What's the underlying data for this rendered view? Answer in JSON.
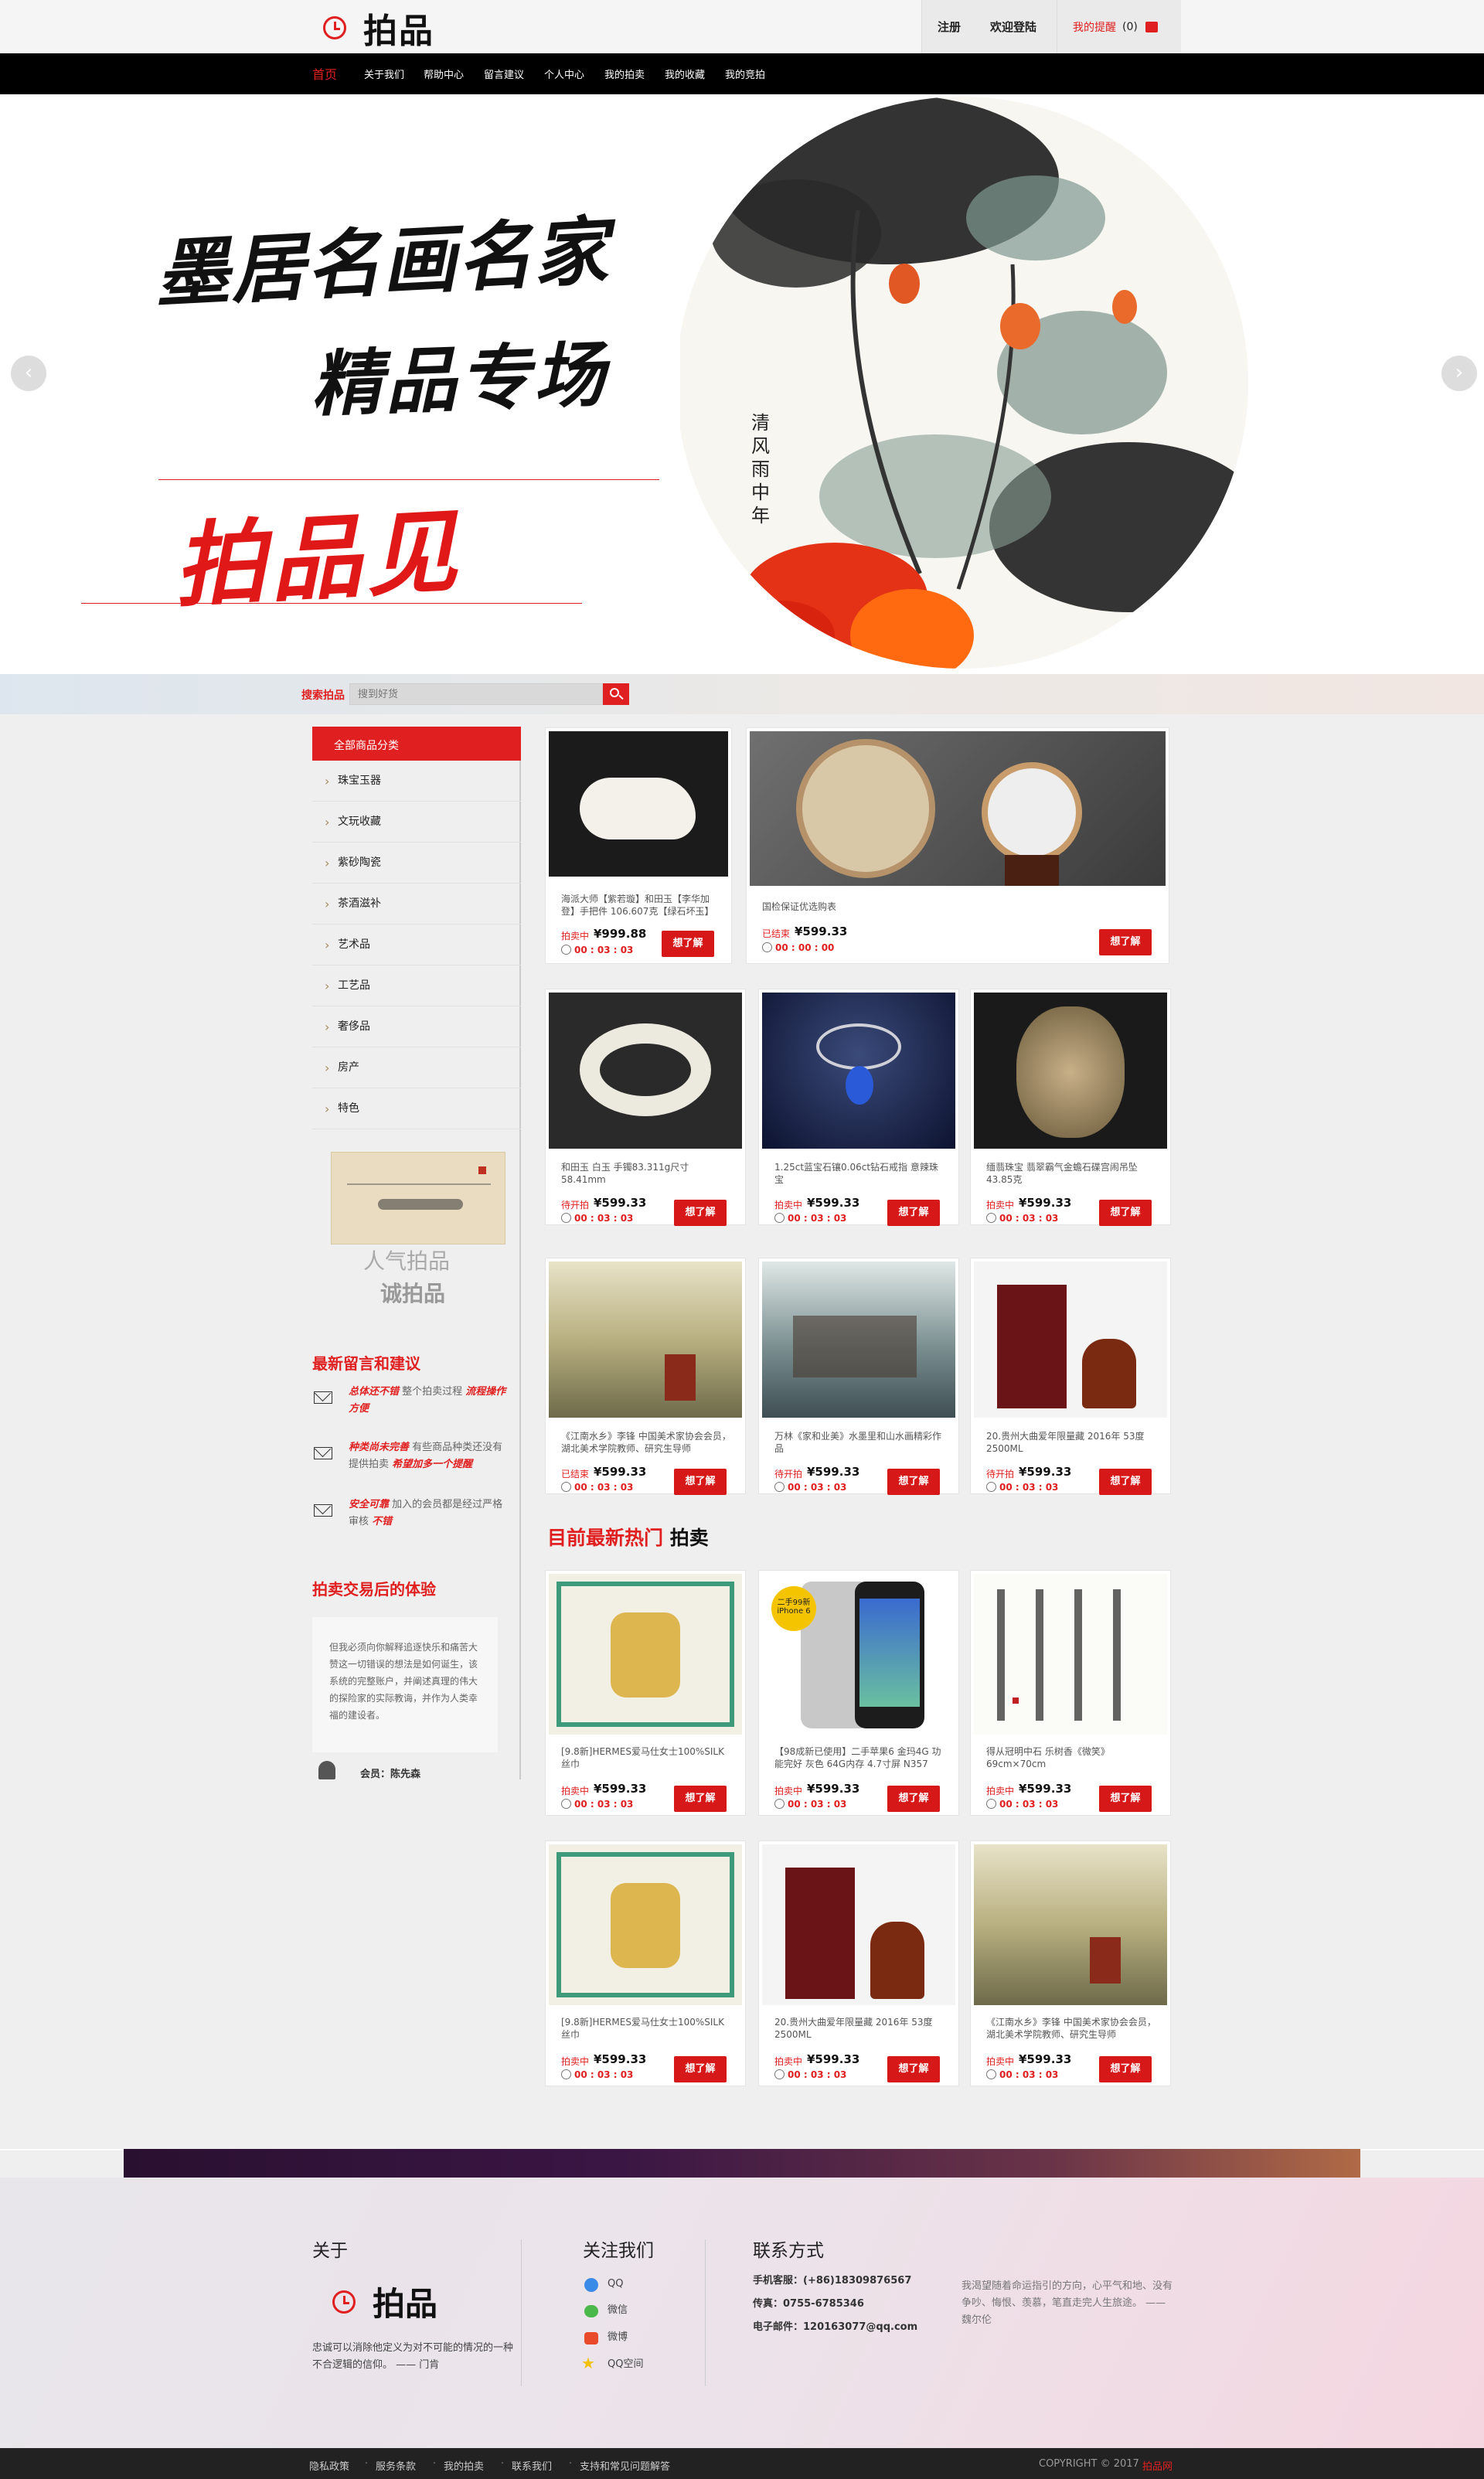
{
  "header": {
    "logo_text": "拍品",
    "register": "注册",
    "login": "欢迎登陆",
    "my_reminder": "我的提醒",
    "reminder_count": "(0)"
  },
  "nav": {
    "items": [
      "首页",
      "关于我们",
      "帮助中心",
      "留言建议",
      "个人中心",
      "我的拍卖",
      "我的收藏",
      "我的竞拍"
    ]
  },
  "banner": {
    "line1": "墨居名画名家",
    "line2": "精品专场",
    "line3": "拍品见",
    "seal_text": "清风雨中年",
    "prev": "‹",
    "next": "›"
  },
  "search": {
    "label": "搜索拍品",
    "placeholder": "搜到好货"
  },
  "sidebar": {
    "category_head": "全部商品分类",
    "categories": [
      "珠宝玉器",
      "文玩收藏",
      "紫砂陶瓷",
      "茶酒滋补",
      "艺术品",
      "工艺品",
      "奢侈品",
      "房产",
      "特色"
    ],
    "promo_line1": "人气拍品",
    "promo_line2": "诚拍品",
    "messages_title": "最新留言和建议",
    "messages": [
      {
        "highlight": "总体还不错",
        "text": " 整个拍卖过程 ",
        "highlight2": "流程操作方便"
      },
      {
        "highlight": "种类尚未完善",
        "text": " 有些商品种类还没有提供拍卖 ",
        "highlight2": "希望加多一个提醒"
      },
      {
        "highlight": "安全可靠",
        "text": " 加入的会员都是经过严格审核 ",
        "highlight2": "不错"
      }
    ],
    "experience_title": "拍卖交易后的体验",
    "experience_quote": "但我必须向你解释追逐快乐和痛苦大赞这一切错误的想法是如何诞生，该系统的完整账户，并阐述真理的伟大的探险家的实际教诲，并作为人类幸福的建设者。",
    "member_label": "会员：陈先森"
  },
  "products": [
    {
      "name": "海派大师【紫若璇】和田玉【李华加登】手把件 106.607克【绿石坏玉】",
      "status": "拍卖中",
      "price": "¥999.88",
      "time": "00 : 03 : 03",
      "btn": "想了解"
    },
    {
      "name": "国检保证优选购表",
      "status": "已结束",
      "price": "¥599.33",
      "time": "00 : 00 : 00",
      "btn": "想了解"
    },
    {
      "name": "和田玉 白玉 手镯83.311g尺寸58.41mm",
      "status": "待开拍",
      "price": "¥599.33",
      "time": "00 : 03 : 03",
      "btn": "想了解"
    },
    {
      "name": "1.25ct蓝宝石镶0.06ct钻石戒指 意辣珠宝",
      "status": "拍卖中",
      "price": "¥599.33",
      "time": "00 : 03 : 03",
      "btn": "想了解"
    },
    {
      "name": "缅翡珠宝 翡翠霸气金蟾石碟宫闹吊坠43.85克",
      "status": "拍卖中",
      "price": "¥599.33",
      "time": "00 : 03 : 03",
      "btn": "想了解"
    },
    {
      "name": "《江南水乡》李锋 中国美术家协会会员，湖北美术学院教师、研究生导师",
      "status": "已结束",
      "price": "¥599.33",
      "time": "00 : 03 : 03",
      "btn": "想了解"
    },
    {
      "name": "万林《家和业美》水墨里和山水画精彩作品",
      "status": "待开拍",
      "price": "¥599.33",
      "time": "00 : 03 : 03",
      "btn": "想了解"
    },
    {
      "name": "20.贵州大曲爱年限量藏 2016年 53度 2500ML",
      "status": "待开拍",
      "price": "¥599.33",
      "time": "00 : 03 : 03",
      "btn": "想了解"
    }
  ],
  "hot": {
    "title_red": "目前最新热门",
    "title_black": " 拍卖",
    "iphone_badge": "二手99新",
    "iphone_badge2": "iPhone 6",
    "items": [
      {
        "name": "[9.8新]HERMES爱马仕女士100%SILK丝巾",
        "status": "拍卖中",
        "price": "¥599.33",
        "time": "00 : 03 : 03",
        "btn": "想了解"
      },
      {
        "name": "【98成新已使用】二手苹果6 金玛4G 功能完好 灰色 64G内存 4.7寸屏 N357",
        "status": "拍卖中",
        "price": "¥599.33",
        "time": "00 : 03 : 03",
        "btn": "想了解"
      },
      {
        "name": "得从冠明中石 乐树香《微笑》69cm×70cm",
        "status": "拍卖中",
        "price": "¥599.33",
        "time": "00 : 03 : 03",
        "btn": "想了解"
      },
      {
        "name": "[9.8新]HERMES爱马仕女士100%SILK丝巾",
        "status": "拍卖中",
        "price": "¥599.33",
        "time": "00 : 03 : 03",
        "btn": "想了解"
      },
      {
        "name": "20.贵州大曲爱年限量藏 2016年 53度 2500ML",
        "status": "拍卖中",
        "price": "¥599.33",
        "time": "00 : 03 : 03",
        "btn": "想了解"
      },
      {
        "name": "《江南水乡》李锋 中国美术家协会会员，湖北美术学院教师、研究生导师",
        "status": "拍卖中",
        "price": "¥599.33",
        "time": "00 : 03 : 03",
        "btn": "想了解"
      }
    ]
  },
  "footer": {
    "about_title": "关于",
    "about_logo": "拍品",
    "about_text": "忠诚可以消除他定义为对不可能的情况的一种不合逻辑的信仰。 —— 门肯",
    "follow_title": "关注我们",
    "follow": [
      "QQ",
      "微信",
      "微博",
      "QQ空间"
    ],
    "contact_title": "联系方式",
    "phone": "手机客服：(+86)18309876567",
    "fax": "传真：0755-6785346",
    "email": "电子邮件：120163077@qq.com",
    "quote": "我渴望随着命运指引的方向，心平气和地、没有争吵、悔恨、羡慕，笔直走完人生旅途。 —— 魏尔伦",
    "bottom_links": [
      "隐私政策",
      "服务条款",
      "我的拍卖",
      "联系我们",
      "支持和常见问题解答"
    ],
    "copyright": "COPYRIGHT © 2017",
    "copyright_brand": "拍品网"
  },
  "colors": {
    "accent": "#e02020",
    "nav_bg": "#000000"
  }
}
